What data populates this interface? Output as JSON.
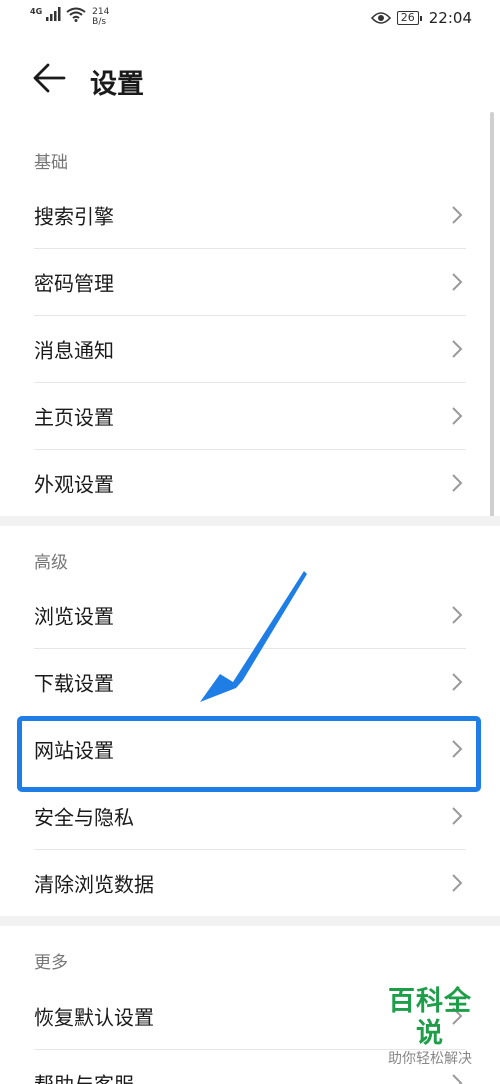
{
  "status_bar": {
    "network": "4G",
    "speed_value": "214",
    "speed_unit": "B/s",
    "battery": "26",
    "time": "22:04"
  },
  "header": {
    "title": "设置"
  },
  "sections": [
    {
      "title": "基础",
      "items": [
        "搜索引擎",
        "密码管理",
        "消息通知",
        "主页设置",
        "外观设置"
      ]
    },
    {
      "title": "高级",
      "items": [
        "浏览设置",
        "下载设置",
        "网站设置",
        "安全与隐私",
        "清除浏览数据"
      ]
    },
    {
      "title": "更多",
      "items": [
        "恢复默认设置",
        "帮助与客服"
      ]
    }
  ],
  "highlighted_item": "网站设置",
  "colors": {
    "annotation": "#1e7ee6",
    "watermark": "#1f9e4a"
  },
  "watermark": {
    "title": "百科全说",
    "subtitle": "助你轻松解决"
  },
  "icons": {
    "back": "arrow-left-icon",
    "chevron": "chevron-right-icon",
    "eye": "eye-icon",
    "wifi": "wifi-icon",
    "signal": "signal-icon"
  }
}
